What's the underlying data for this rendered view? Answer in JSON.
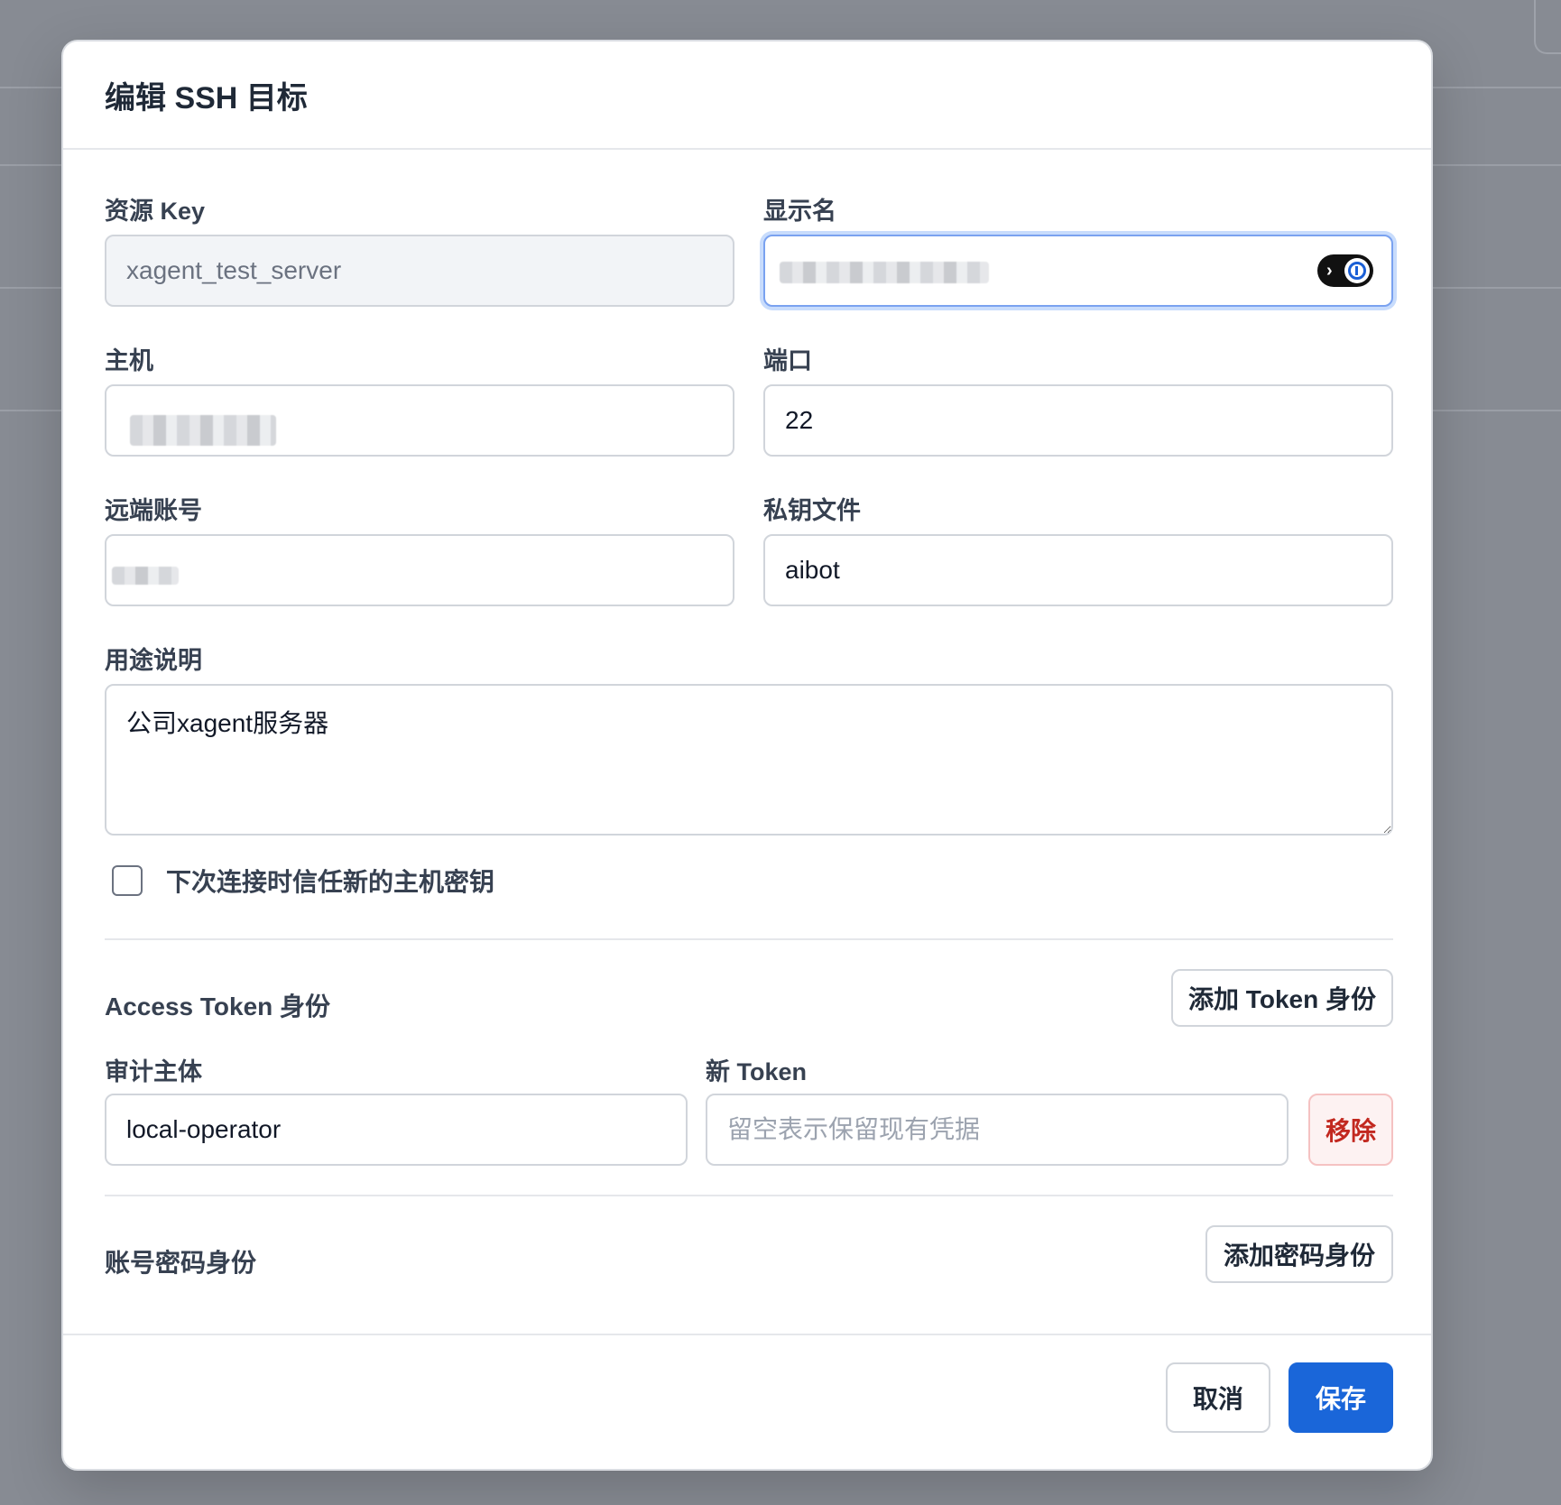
{
  "dialog": {
    "title": "编辑 SSH 目标"
  },
  "form": {
    "resource_key": {
      "label": "资源 Key",
      "value": "xagent_test_server"
    },
    "display_name": {
      "label": "显示名",
      "value": ""
    },
    "host": {
      "label": "主机",
      "value": ""
    },
    "port": {
      "label": "端口",
      "value": "22"
    },
    "remote_account": {
      "label": "远端账号",
      "value": ""
    },
    "private_key_file": {
      "label": "私钥文件",
      "value": "aibot"
    },
    "description": {
      "label": "用途说明",
      "value": "公司xagent服务器"
    },
    "trust_host_key": {
      "label": "下次连接时信任新的主机密钥",
      "checked": false
    }
  },
  "access_token_section": {
    "title": "Access Token 身份",
    "add_button": "添加 Token 身份",
    "audit_subject": {
      "label": "审计主体",
      "value": "local-operator"
    },
    "new_token": {
      "label": "新 Token",
      "value": "",
      "placeholder": "留空表示保留现有凭据"
    },
    "remove_button": "移除"
  },
  "password_section": {
    "title": "账号密码身份",
    "add_button": "添加密码身份"
  },
  "footer": {
    "cancel_button": "取消",
    "save_button": "保存"
  },
  "colors": {
    "primary": "#1a66d9",
    "danger_text": "#c2281f",
    "focus_ring": "#7aa2f0"
  }
}
